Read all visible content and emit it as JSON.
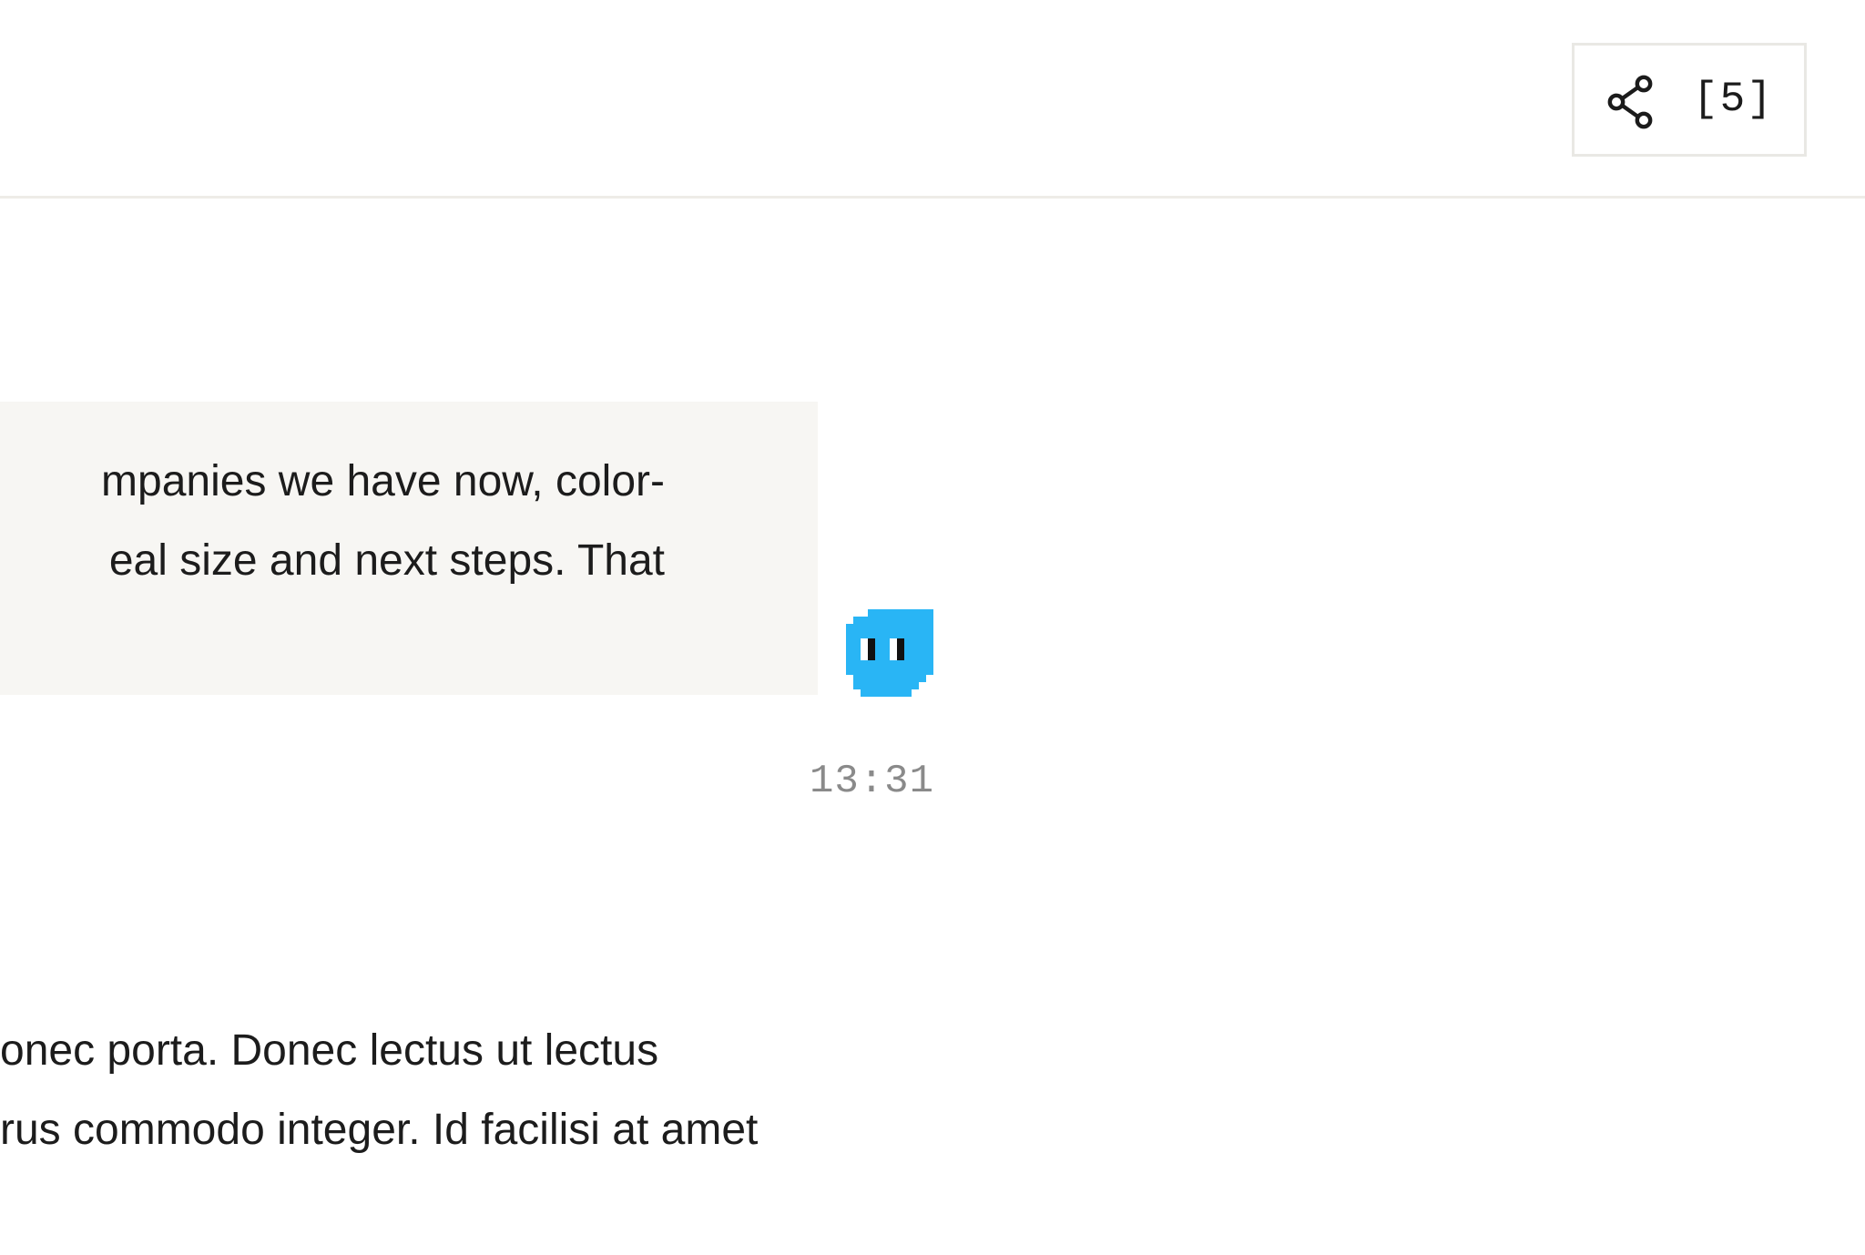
{
  "header": {
    "share_button": {
      "icon": "share-icon",
      "count_label": "[5]"
    }
  },
  "messages": [
    {
      "type": "user",
      "lines": [
        "mpanies we have now, color-",
        "eal size and next steps. That"
      ],
      "timestamp": "13:31",
      "avatar_icon": "pixel-ghost-avatar-icon",
      "avatar_color": "#29b5f5"
    },
    {
      "type": "assistant",
      "lines": [
        "onec porta. Donec lectus ut lectus",
        "rus commodo integer. Id facilisi at amet"
      ]
    }
  ],
  "colors": {
    "bubble_bg": "#f7f6f3",
    "divider": "#eeece7",
    "text": "#1c1c1c",
    "timestamp": "#8a8a8a",
    "accent": "#29b5f5"
  }
}
